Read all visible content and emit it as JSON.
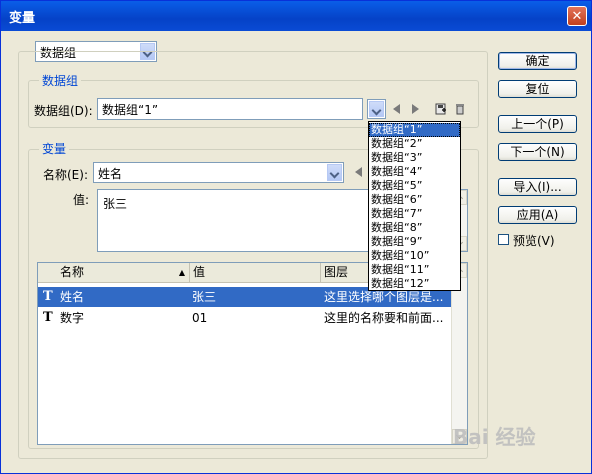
{
  "window": {
    "title": "变量",
    "close_icon": "close-icon"
  },
  "top_combo": {
    "value": "数据组"
  },
  "dataset_group": {
    "label": "数据组",
    "field_label": "数据组(D):",
    "value": "数据组“1”",
    "options": [
      "数据组“1”",
      "数据组“2”",
      "数据组“3”",
      "数据组“4”",
      "数据组“5”",
      "数据组“6”",
      "数据组“7”",
      "数据组“8”",
      "数据组“9”",
      "数据组“10”",
      "数据组“11”",
      "数据组“12”"
    ],
    "selected_index": 0
  },
  "variable_group": {
    "label": "变量",
    "name_label": "名称(E):",
    "name_value": "姓名",
    "value_label": "值:",
    "value_text": "张三"
  },
  "table": {
    "columns": [
      "名称",
      "值",
      "图层"
    ],
    "sort_indicator": "▲",
    "rows": [
      {
        "icon": "T",
        "name": "姓名",
        "value": "张三",
        "layer": "这里选择哪个图层是...",
        "selected": true
      },
      {
        "icon": "T",
        "name": "数字",
        "value": "01",
        "layer": "这里的名称要和前面...",
        "selected": false
      }
    ]
  },
  "buttons": {
    "ok": "确定",
    "reset": "复位",
    "prev": "上一个(P)",
    "next": "下一个(N)",
    "import": "导入(I)...",
    "apply": "应用(A)"
  },
  "preview": {
    "label": "预览(V)",
    "checked": false
  },
  "watermark": {
    "text": "Bai 经验"
  }
}
